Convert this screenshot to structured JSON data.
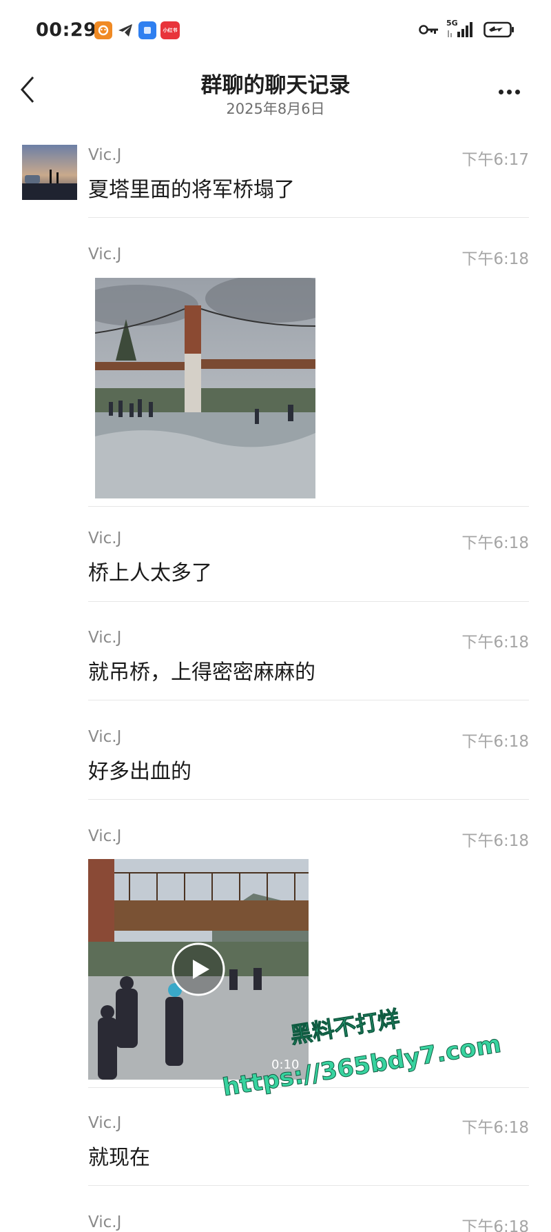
{
  "status_bar": {
    "time": "00:29",
    "network": "5G",
    "app_badge_text": "小红书"
  },
  "header": {
    "title": "群聊的聊天记录",
    "date": "2025年8月6日"
  },
  "messages": [
    {
      "sender": "Vic.J",
      "time": "下午6:17",
      "text": "夏塔里面的将军桥塌了"
    },
    {
      "sender": "Vic.J",
      "time": "下午6:18",
      "type": "image"
    },
    {
      "sender": "Vic.J",
      "time": "下午6:18",
      "text": "桥上人太多了"
    },
    {
      "sender": "Vic.J",
      "time": "下午6:18",
      "text": "就吊桥，上得密密麻麻的"
    },
    {
      "sender": "Vic.J",
      "time": "下午6:18",
      "text": "好多出血的"
    },
    {
      "sender": "Vic.J",
      "time": "下午6:18",
      "type": "video",
      "duration": "0:10"
    },
    {
      "sender": "Vic.J",
      "time": "下午6:18",
      "text": "就现在"
    },
    {
      "sender": "Vic.J",
      "time": "下午6:18",
      "text": ""
    }
  ],
  "watermark": {
    "line1": "黑料不打烊",
    "line2": "https://365bdy7.com"
  },
  "colors": {
    "watermark": "#38d39f",
    "accent_red": "#e8343b",
    "accent_blue": "#2f7ff0",
    "accent_orange": "#f08a24"
  }
}
